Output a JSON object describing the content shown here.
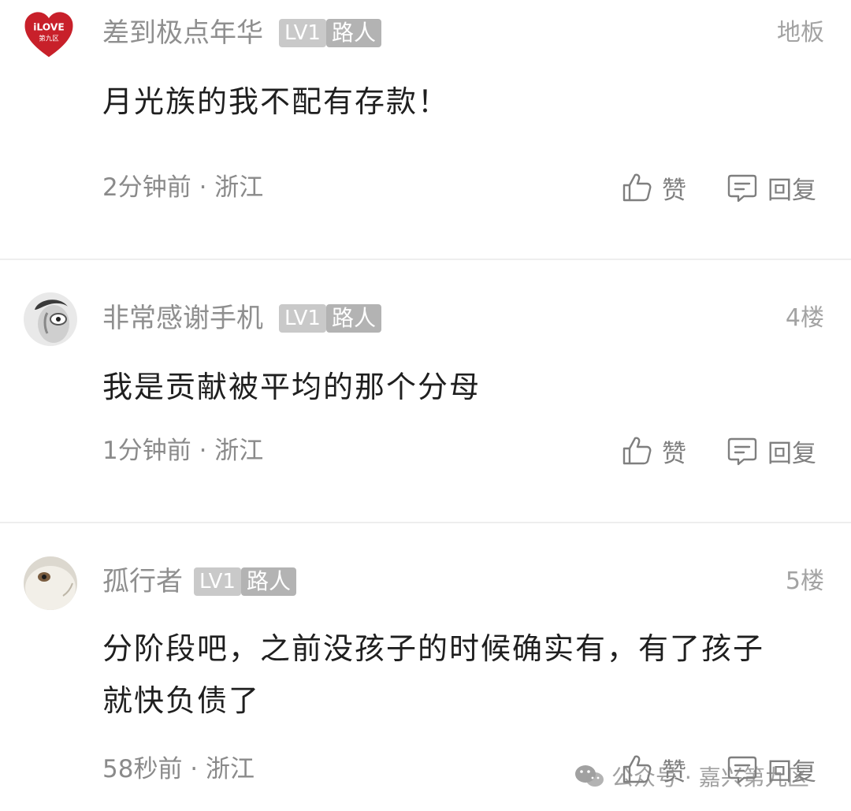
{
  "comments": [
    {
      "username": "差到极点年华",
      "level": "LV1",
      "role": "路人",
      "floor": "地板",
      "content": "月光族的我不配有存款！",
      "time": "2分钟前",
      "location": "浙江",
      "like_label": "赞",
      "reply_label": "回复",
      "avatar_text": "iLOVE",
      "avatar_subtext": "第九区"
    },
    {
      "username": "非常感谢手机",
      "level": "LV1",
      "role": "路人",
      "floor": "4楼",
      "content": "我是贡献被平均的那个分母",
      "time": "1分钟前",
      "location": "浙江",
      "like_label": "赞",
      "reply_label": "回复"
    },
    {
      "username": "孤行者",
      "level": "LV1",
      "role": "路人",
      "floor": "5楼",
      "content": "分阶段吧，之前没孩子的时候确实有，有了孩子就快负债了",
      "time": "58秒前",
      "location": "浙江",
      "like_label": "赞",
      "reply_label": "回复"
    }
  ],
  "meta_separator": " · ",
  "watermark": "公众号 · 嘉兴第九区",
  "colors": {
    "username": "#8f8f8f",
    "content": "#1f1f1f",
    "meta": "#8a8a8a",
    "badge_level": "#c9c9c9",
    "badge_role": "#b3b3b3",
    "avatar_heart": "#c8202a"
  }
}
